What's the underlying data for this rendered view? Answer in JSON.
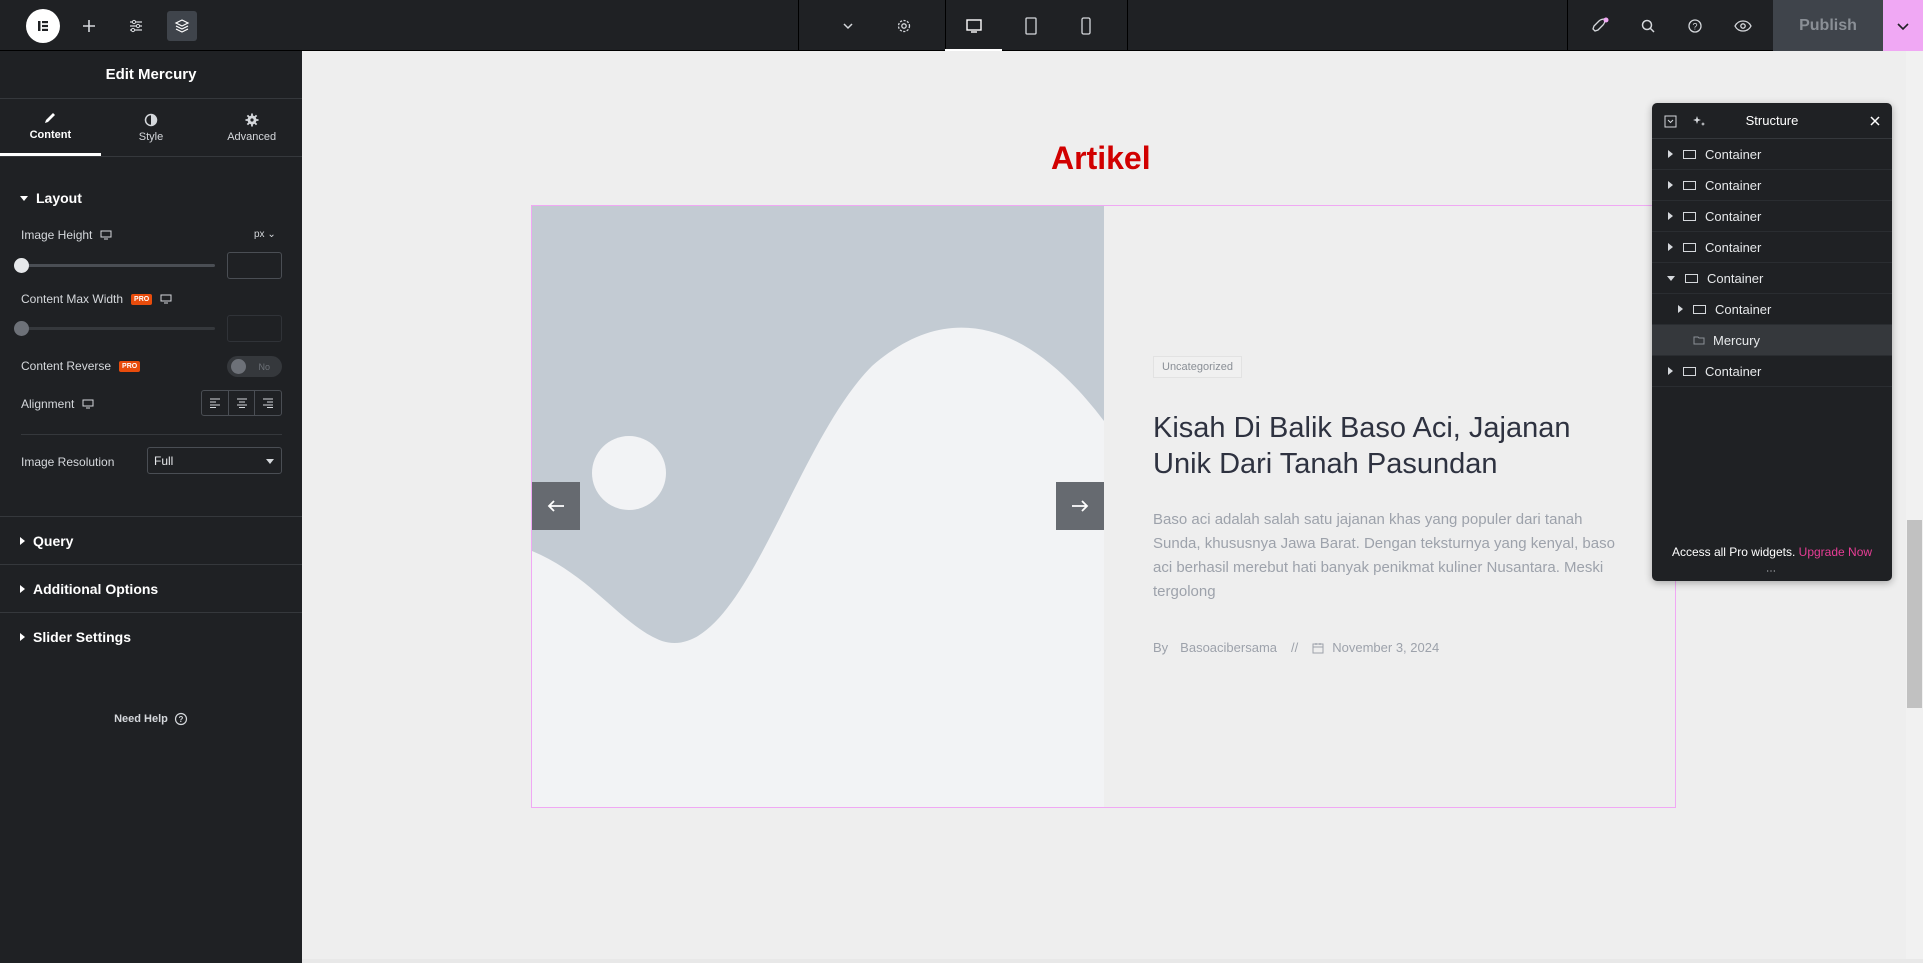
{
  "topbar": {
    "publish_label": "Publish"
  },
  "panel": {
    "title": "Edit Mercury",
    "tabs": [
      {
        "label": "Content",
        "active": true
      },
      {
        "label": "Style",
        "active": false
      },
      {
        "label": "Advanced",
        "active": false
      }
    ],
    "layout_section": "Layout",
    "image_height_label": "Image Height",
    "image_height_unit": "px",
    "content_max_width_label": "Content Max Width",
    "pro_badge": "PRO",
    "content_reverse_label": "Content Reverse",
    "content_reverse_toggle": "No",
    "alignment_label": "Alignment",
    "image_resolution_label": "Image Resolution",
    "image_resolution_value": "Full",
    "query_section": "Query",
    "additional_options_section": "Additional Options",
    "slider_settings_section": "Slider Settings",
    "need_help": "Need Help"
  },
  "canvas": {
    "heading": "Artikel",
    "category": "Uncategorized",
    "article_title": "Kisah Di Balik Baso Aci, Jajanan Unik Dari Tanah Pasundan",
    "excerpt": "Baso aci adalah salah satu jajanan khas yang populer dari tanah Sunda, khususnya Jawa Barat. Dengan teksturnya yang kenyal, baso aci berhasil merebut hati banyak penikmat kuliner Nusantara. Meski tergolong",
    "meta_by": "By",
    "meta_author": "Basoacibersama",
    "meta_sep": "//",
    "meta_date": "November 3, 2024"
  },
  "structure": {
    "title": "Structure",
    "items": [
      {
        "label": "Container"
      },
      {
        "label": "Container"
      },
      {
        "label": "Container"
      },
      {
        "label": "Container"
      },
      {
        "label": "Container"
      },
      {
        "label": "Container"
      },
      {
        "label": "Mercury"
      },
      {
        "label": "Container"
      }
    ],
    "footer_text": "Access all Pro widgets.",
    "footer_link": "Upgrade Now"
  },
  "colors": {
    "accent": "#f0a8f4",
    "heading": "#d10000",
    "pro": "#e84c0c",
    "upgrade": "#e73d95"
  }
}
